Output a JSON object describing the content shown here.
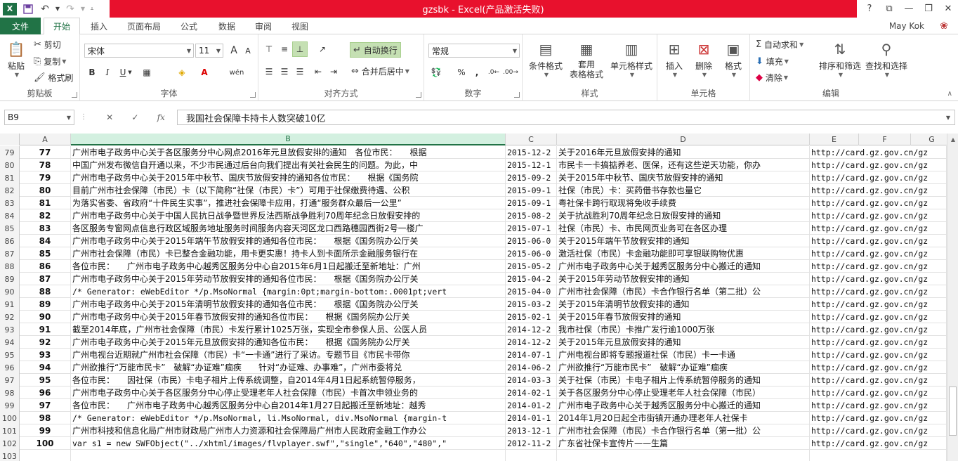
{
  "window": {
    "title": "gzsbk - Excel(产品激活失败)",
    "logo": "X"
  },
  "qat": {
    "save_icon": "save-icon",
    "undo_icon": "undo-icon",
    "redo_icon": "redo-icon"
  },
  "window_controls": {
    "help": "?",
    "restore_ribbon": "⧉",
    "minimize": "—",
    "maximize": "❐",
    "close": "✕"
  },
  "tabs": {
    "file": "文件",
    "items": [
      "开始",
      "插入",
      "页面布局",
      "公式",
      "数据",
      "审阅",
      "视图"
    ]
  },
  "user": {
    "name": "May Kok"
  },
  "ribbon": {
    "clipboard": {
      "label": "剪贴板",
      "paste": "粘贴",
      "cut": "剪切",
      "copy": "复制",
      "format_painter": "格式刷"
    },
    "font": {
      "label": "字体",
      "name": "宋体",
      "size": "11",
      "bold": "B",
      "italic": "I",
      "underline": "U",
      "grow": "A",
      "shrink": "A"
    },
    "alignment": {
      "label": "对齐方式",
      "wrap": "自动换行",
      "merge": "合并后居中"
    },
    "number": {
      "label": "数字",
      "format": "常规",
      "percent": "%",
      "comma": ","
    },
    "styles": {
      "label": "样式",
      "conditional": "条件格式",
      "table_line1": "套用",
      "table_line2": "表格格式",
      "cell_styles": "单元格样式"
    },
    "cells": {
      "label": "单元格",
      "insert": "插入",
      "delete": "删除",
      "format": "格式"
    },
    "editing": {
      "label": "编辑",
      "autosum": "自动求和",
      "fill": "填充",
      "clear": "清除",
      "sort": "排序和筛选",
      "find": "查找和选择"
    }
  },
  "formula_bar": {
    "name_box": "B9",
    "cancel": "✕",
    "enter": "✓",
    "fx": "fx",
    "content": "我国社会保障卡持卡人数突破10亿"
  },
  "columns": [
    "A",
    "B",
    "C",
    "D",
    "E",
    "F",
    "G"
  ],
  "rows": [
    {
      "num": "79",
      "a": "77",
      "b": "广州市电子政务中心关于各区服务分中心网点2016年元旦放假安排的通知　各位市民：　　根据",
      "c": "2015-12-2",
      "d": "关于2016年元旦放假安排的通知",
      "e": "http://card.gz.gov.cn/gz"
    },
    {
      "num": "80",
      "a": "78",
      "b": "中国广州发布微信自开通以来，不少市民通过后台向我们提出有关社会民生的问题。为此，中",
      "c": "2015-12-1",
      "d": "市民卡一卡搞掂养老、医保，还有这些逆天功能，你办",
      "e": "http://card.gz.gov.cn/gz"
    },
    {
      "num": "81",
      "a": "79",
      "b": "广州市电子政务中心关于2015年中秋节、国庆节放假安排的通知各位市民：　　根据《国务院",
      "c": "2015-09-2",
      "d": "关于2015年中秋节、国庆节放假安排的通知",
      "e": "http://card.gz.gov.cn/gz"
    },
    {
      "num": "82",
      "a": "80",
      "b": "目前广州市社会保障（市民）卡（以下简称“社保（市民）卡”）可用于社保缴费待遇、公积",
      "c": "2015-09-1",
      "d": "社保（市民）卡：买药借书存款也量它",
      "e": "http://card.gz.gov.cn/gz"
    },
    {
      "num": "83",
      "a": "81",
      "b": "为落实省委、省政府“十件民生实事”，推进社会保障卡应用，打通“服务群众最后一公里”",
      "c": "2015-09-1",
      "d": "粤社保卡跨行取现将免收手续费",
      "e": "http://card.gz.gov.cn/gz"
    },
    {
      "num": "84",
      "a": "82",
      "b": "广州市电子政务中心关于中国人民抗日战争暨世界反法西斯战争胜利70周年纪念日放假安排的",
      "c": "2015-08-2",
      "d": "关于抗战胜利70周年纪念日放假安排的通知",
      "e": "http://card.gz.gov.cn/gz"
    },
    {
      "num": "85",
      "a": "83",
      "b": "各区服务专窗网点信息行政区域服务地址服务时间服务内容天河区龙口西路穗园西街2号一楼广",
      "c": "2015-07-1",
      "d": "社保（市民）卡、市民网页业务可在各区办理",
      "e": "http://card.gz.gov.cn/gz"
    },
    {
      "num": "86",
      "a": "84",
      "b": "广州市电子政务中心关于2015年端午节放假安排的通知各位市民：　　根据《国务院办公厅关",
      "c": "2015-06-0",
      "d": "关于2015年端午节放假安排的通知",
      "e": "http://card.gz.gov.cn/gz"
    },
    {
      "num": "87",
      "a": "85",
      "b": "广州市社会保障（市民）卡已整合金融功能，用卡更实惠！持卡人到卡面所示金融服务银行在",
      "c": "2015-06-0",
      "d": "激活社保（市民）卡金融功能即可享银联购物优惠",
      "e": "http://card.gz.gov.cn/gz"
    },
    {
      "num": "88",
      "a": "86",
      "b": "各位市民：　　广州市电子政务中心越秀区服务分中心自2015年6月1日起搬迁至新地址：广州",
      "c": "2015-05-2",
      "d": "广州市电子政务中心关于越秀区服务分中心搬迁的通知",
      "e": "http://card.gz.gov.cn/gz"
    },
    {
      "num": "89",
      "a": "87",
      "b": "广州市电子政务中心关于2015年劳动节放假安排的通知各位市民：　　根据《国务院办公厅关",
      "c": "2015-04-2",
      "d": "关于2015年劳动节放假安排的通知",
      "e": "http://card.gz.gov.cn/gz"
    },
    {
      "num": "90",
      "a": "88",
      "b": "/* Generator: eWebEditor */p.MsoNormal {margin:0pt;margin-bottom:.0001pt;vert",
      "c": "2015-04-0",
      "d": "广州市社会保障（市民）卡合作银行名单（第二批）公",
      "e": "http://card.gz.gov.cn/gz",
      "mono": true
    },
    {
      "num": "91",
      "a": "89",
      "b": "广州市电子政务中心关于2015年清明节放假安排的通知各位市民：　　根据《国务院办公厅关",
      "c": "2015-03-2",
      "d": "关于2015年清明节放假安排的通知",
      "e": "http://card.gz.gov.cn/gz"
    },
    {
      "num": "92",
      "a": "90",
      "b": "广州市电子政务中心关于2015年春节放假安排的通知各位市民：　　根据《国务院办公厅关",
      "c": "2015-02-1",
      "d": "关于2015年春节放假安排的通知",
      "e": "http://card.gz.gov.cn/gz"
    },
    {
      "num": "93",
      "a": "91",
      "b": "截至2014年底，广州市社会保障（市民）卡发行累计1025万张，实现全市参保人员、公医人员",
      "c": "2014-12-2",
      "d": "我市社保（市民）卡推广发行逾1000万张",
      "e": "http://card.gz.gov.cn/gz"
    },
    {
      "num": "94",
      "a": "92",
      "b": "广州市电子政务中心关于2015年元旦放假安排的通知各位市民：　　根据《国务院办公厅关",
      "c": "2014-12-2",
      "d": "关于2015年元旦放假安排的通知",
      "e": "http://card.gz.gov.cn/gz"
    },
    {
      "num": "95",
      "a": "93",
      "b": "广州电视台近期就广州市社会保障（市民）卡“一卡通”进行了采访。专题节目《市民卡带你",
      "c": "2014-07-1",
      "d": "广州电视台即将专题报道社保（市民）卡一卡通",
      "e": "http://card.gz.gov.cn/gz"
    },
    {
      "num": "96",
      "a": "94",
      "b": "广州欲推行“万能市民卡”　破解“办证难”痼疾　　针对“办证难、办事难”，广州市委将兑",
      "c": "2014-06-2",
      "d": "广州欲推行“万能市民卡”　破解“办证难”痼疾",
      "e": "http://card.gz.gov.cn/gz"
    },
    {
      "num": "97",
      "a": "95",
      "b": "各位市民：　　因社保（市民）卡电子相片上传系统调整，自2014年4月1日起系统暂停服务，",
      "c": "2014-03-3",
      "d": "关于社保（市民）卡电子相片上传系统暂停服务的通知",
      "e": "http://card.gz.gov.cn/gz"
    },
    {
      "num": "98",
      "a": "96",
      "b": "广州市电子政务中心关于各区服务分中心停止受理老年人社会保障（市民）卡首次申领业务的",
      "c": "2014-02-1",
      "d": "关于各区服务分中心停止受理老年人社会保障（市民）",
      "e": "http://card.gz.gov.cn/gz"
    },
    {
      "num": "99",
      "a": "97",
      "b": "各位市民：　　广州市电子政务中心越秀区服务分中心自2014年1月27日起搬迁至新地址：越秀",
      "c": "2014-01-2",
      "d": "广州市电子政务中心关于越秀区服务分中心搬迁的通知",
      "e": "http://card.gz.gov.cn/gz"
    },
    {
      "num": "100",
      "a": "98",
      "b": "/* Generator: eWebEditor */p.MsoNormal, li.MsoNormal, div.MsoNormal {margin-t",
      "c": "2014-01-1",
      "d": "2014年1月20日起全市街镇开通办理老年人社保卡",
      "e": "http://card.gz.gov.cn/gz",
      "mono": true
    },
    {
      "num": "101",
      "a": "99",
      "b": "广州市科技和信息化局广州市财政局广州市人力资源和社会保障局广州市人民政府金融工作办公",
      "c": "2013-12-1",
      "d": "广州市社会保障（市民）卡合作银行名单（第一批）公",
      "e": "http://card.gz.gov.cn/gz"
    },
    {
      "num": "102",
      "a": "100",
      "b": "var s1 = new SWFObject(\"../xhtml/images/flvplayer.swf\",\"single\",\"640\",\"480\",\"",
      "c": "2012-11-2",
      "d": "广东省社保卡宣传片——生篇",
      "e": "http://card.gz.gov.cn/gz",
      "mono": true
    },
    {
      "num": "103",
      "a": "",
      "b": "",
      "c": "",
      "d": "",
      "e": ""
    }
  ]
}
